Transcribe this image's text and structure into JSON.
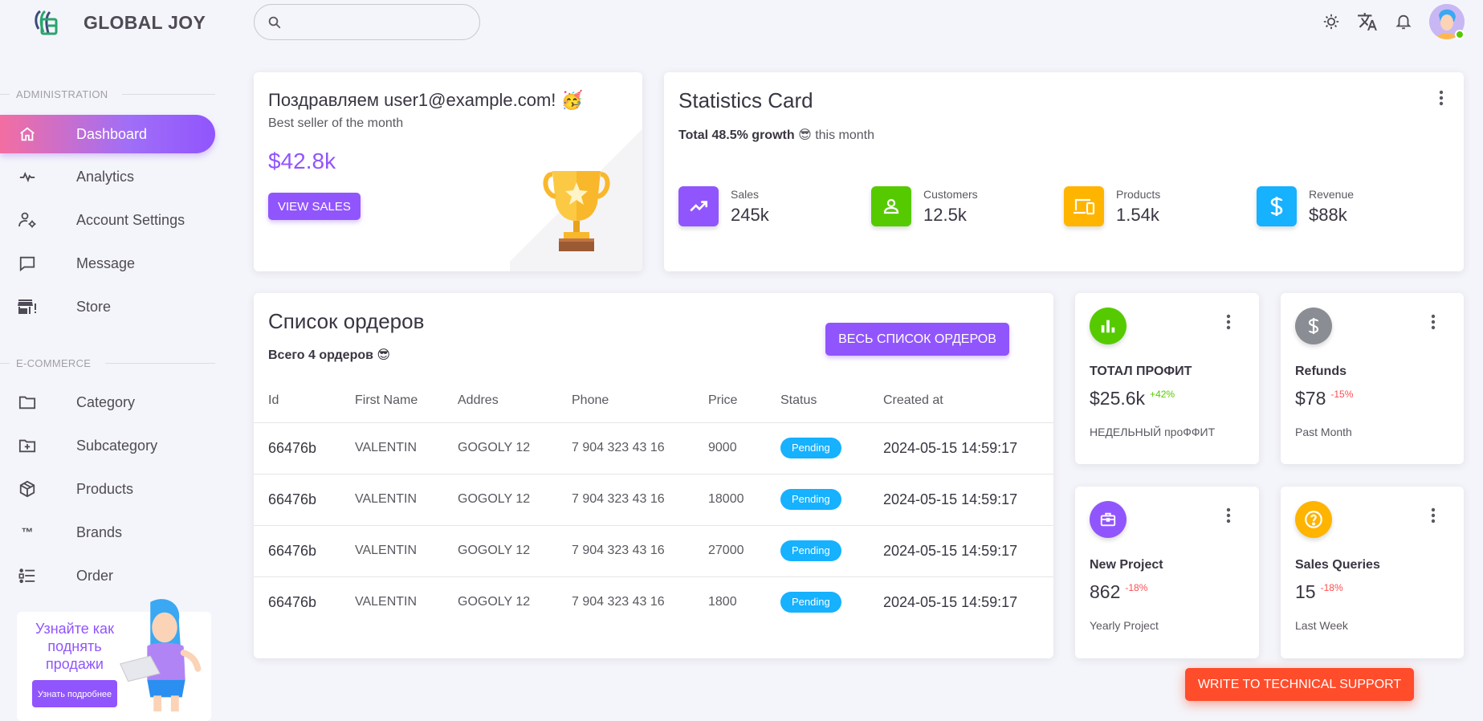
{
  "brand": {
    "name": "GLOBAL JOY"
  },
  "search": {
    "placeholder": ""
  },
  "sidebar": {
    "sections": [
      {
        "title": "ADMINISTRATION"
      },
      {
        "title": "E-COMMERCE"
      }
    ],
    "items": [
      {
        "label": "Dashboard",
        "icon": "home-icon",
        "active": true
      },
      {
        "label": "Analytics",
        "icon": "pulse-icon"
      },
      {
        "label": "Account Settings",
        "icon": "account-cog-icon"
      },
      {
        "label": "Message",
        "icon": "message-icon"
      },
      {
        "label": "Store",
        "icon": "store-icon"
      },
      {
        "label": "Category",
        "icon": "folder-icon"
      },
      {
        "label": "Subcategory",
        "icon": "folder-plus-icon"
      },
      {
        "label": "Products",
        "icon": "cube-icon"
      },
      {
        "label": "Brands",
        "icon": "trademark-icon"
      },
      {
        "label": "Order",
        "icon": "list-icon"
      }
    ],
    "promo": {
      "text": "Узнайте как поднять продажи",
      "button": "Узнать подробнее"
    }
  },
  "header": {
    "icons": [
      "brightness-icon",
      "translate-icon",
      "bell-icon"
    ],
    "status_color": "#56ca00"
  },
  "congrats": {
    "title": "Поздравляем user1@example.com! 🥳",
    "subtitle": "Best seller of the month",
    "amount": "$42.8k",
    "button": "VIEW SALES"
  },
  "stats": {
    "title": "Statistics Card",
    "growth": "Total 48.5% growth",
    "emoji": "😎",
    "period": "this month",
    "items": [
      {
        "label": "Sales",
        "value": "245k",
        "color": "#9155fd",
        "icon": "trending-up-icon"
      },
      {
        "label": "Customers",
        "value": "12.5k",
        "color": "#56ca00",
        "icon": "account-icon"
      },
      {
        "label": "Products",
        "value": "1.54k",
        "color": "#ffb400",
        "icon": "devices-icon"
      },
      {
        "label": "Revenue",
        "value": "$88k",
        "color": "#16b1ff",
        "icon": "dollar-icon"
      }
    ]
  },
  "orders": {
    "title": "Список ордеров",
    "subtitle": "Всего 4 ордеров 😎",
    "button": "ВЕСЬ СПИСОК ОРДЕРОВ",
    "columns": [
      "Id",
      "First Name",
      "Addres",
      "Phone",
      "Price",
      "Status",
      "Created at"
    ],
    "rows": [
      {
        "id": "66476b",
        "name": "VALENTIN",
        "address": "GOGOLY 12",
        "phone": "7 904 323 43 16",
        "price": "9000",
        "status": "Pending",
        "created": "2024-05-15 14:59:17"
      },
      {
        "id": "66476b",
        "name": "VALENTIN",
        "address": "GOGOLY 12",
        "phone": "7 904 323 43 16",
        "price": "18000",
        "status": "Pending",
        "created": "2024-05-15 14:59:17"
      },
      {
        "id": "66476b",
        "name": "VALENTIN",
        "address": "GOGOLY 12",
        "phone": "7 904 323 43 16",
        "price": "27000",
        "status": "Pending",
        "created": "2024-05-15 14:59:17"
      },
      {
        "id": "66476b",
        "name": "VALENTIN",
        "address": "GOGOLY 12",
        "phone": "7 904 323 43 16",
        "price": "1800",
        "status": "Pending",
        "created": "2024-05-15 14:59:17"
      }
    ]
  },
  "mini_cards": [
    {
      "title": "ТОТАЛ ПРОФИТ",
      "value": "$25.6k",
      "delta": "+42%",
      "sub": "НЕДЕЛЬНЫЙ проФФИТ",
      "color": "#56ca00",
      "icon": "bar-chart-icon"
    },
    {
      "title": "Refunds",
      "value": "$78",
      "delta": "-15%",
      "sub": "Past Month",
      "color": "#8a8d93",
      "icon": "dollar-icon"
    },
    {
      "title": "New Project",
      "value": "862",
      "delta": "-18%",
      "sub": "Yearly Project",
      "color": "#9155fd",
      "icon": "briefcase-icon"
    },
    {
      "title": "Sales Queries",
      "value": "15",
      "delta": "-18%",
      "sub": "Last Week",
      "color": "#ffb400",
      "icon": "help-circle-icon"
    }
  ],
  "support": {
    "button": "WRITE TO TECHNICAL SUPPORT"
  }
}
